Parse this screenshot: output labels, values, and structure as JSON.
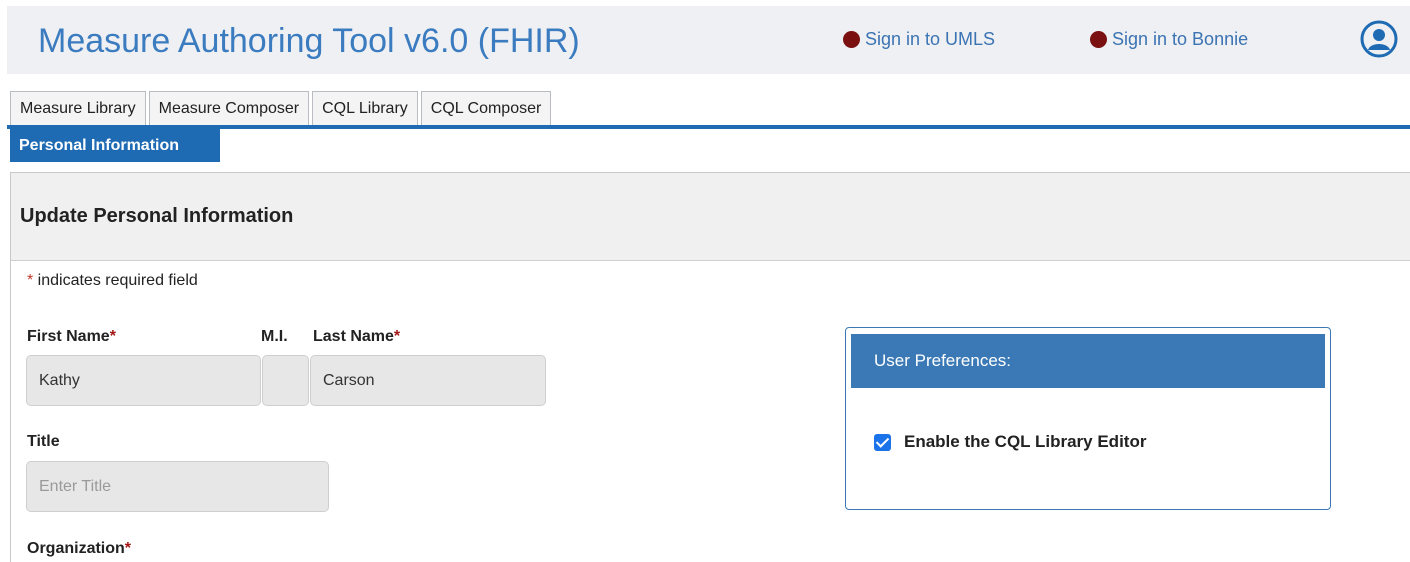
{
  "header": {
    "app_title": "Measure Authoring Tool v6.0 (FHIR)",
    "signin_umls": "Sign in to UMLS",
    "signin_bonnie": "Sign in to Bonnie",
    "user_icon": "user-account-icon",
    "accent_color": "#3b7bbf",
    "status_dot_color": "#7a1010"
  },
  "tabs": [
    {
      "label": "Measure Library"
    },
    {
      "label": "Measure Composer"
    },
    {
      "label": "CQL Library"
    },
    {
      "label": "CQL Composer"
    }
  ],
  "section_tab": "Personal Information",
  "form": {
    "title": "Update Personal Information",
    "required_star": "*",
    "required_note": " indicates required field",
    "first_name": {
      "label": "First Name",
      "value": "Kathy"
    },
    "middle_initial": {
      "label": "M.I.",
      "value": ""
    },
    "last_name": {
      "label": "Last Name",
      "value": "Carson"
    },
    "title_field": {
      "label": "Title",
      "value": "",
      "placeholder": "Enter Title"
    },
    "organization": {
      "label": "Organization"
    }
  },
  "preferences": {
    "heading": "User Preferences:",
    "option_label": "Enable the CQL Library Editor",
    "option_checked": true
  }
}
